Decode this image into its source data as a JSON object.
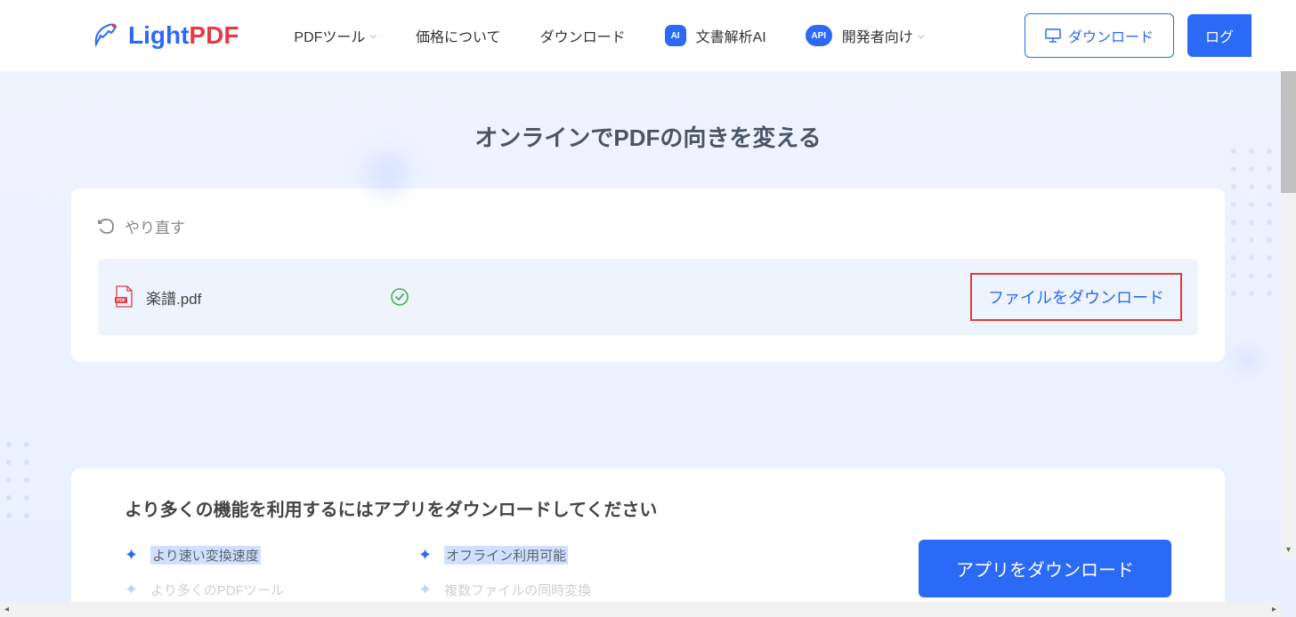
{
  "logo": {
    "text_light": "Light",
    "text_pdf": "PDF"
  },
  "nav": {
    "pdf_tools": "PDFツール",
    "pricing": "価格について",
    "download": "ダウンロード",
    "ai_doc": "文書解析AI",
    "ai_badge": "AI",
    "developer": "開発者向け",
    "api_badge": "API"
  },
  "header_buttons": {
    "download": "ダウンロード",
    "login": "ログ"
  },
  "page": {
    "title": "オンラインでPDFの向きを変える"
  },
  "action": {
    "restart": "やり直す"
  },
  "file": {
    "name": "楽譜.pdf",
    "download_label": "ファイルをダウンロード"
  },
  "promo": {
    "title": "より多くの機能を利用するにはアプリをダウンロードしてください",
    "features": [
      "より速い変換速度",
      "オフライン利用可能",
      "より多くのPDFツール",
      "複数ファイルの同時変換"
    ],
    "button": "アプリをダウンロード"
  }
}
